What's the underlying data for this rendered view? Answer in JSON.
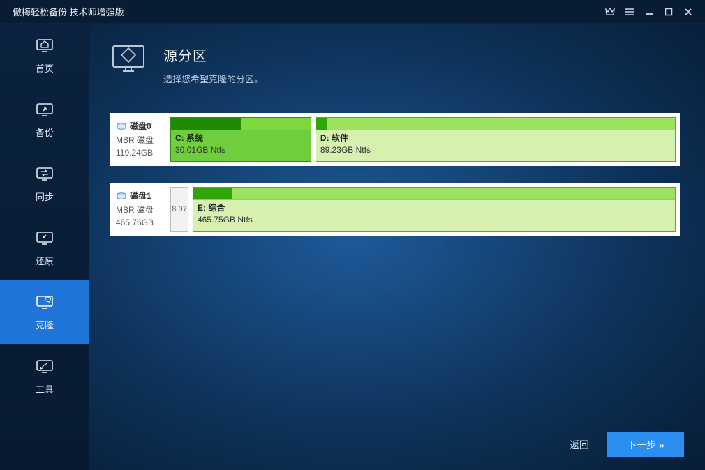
{
  "titlebar": {
    "app_title": "傲梅轻松备份 技术师增强版"
  },
  "sidebar": {
    "items": [
      {
        "label": "首页",
        "icon": "home"
      },
      {
        "label": "备份",
        "icon": "backup"
      },
      {
        "label": "同步",
        "icon": "sync"
      },
      {
        "label": "还原",
        "icon": "restore"
      },
      {
        "label": "克隆",
        "icon": "clone"
      },
      {
        "label": "工具",
        "icon": "tools"
      }
    ],
    "active_index": 4
  },
  "page": {
    "title": "源分区",
    "subtitle": "选择您希望克隆的分区。"
  },
  "disks": [
    {
      "name": "磁盘0",
      "type": "MBR 磁盘",
      "size": "119.24GB",
      "partitions": [
        {
          "label": "C: 系统",
          "info": "30.01GB Ntfs",
          "flex": 28,
          "used_pct": 50,
          "selected": true
        },
        {
          "label": "D: 软件",
          "info": "89.23GB Ntfs",
          "flex": 72,
          "used_pct": 3,
          "selected": false
        }
      ]
    },
    {
      "name": "磁盘1",
      "type": "MBR 磁盘",
      "size": "465.76GB",
      "small_prefix": "8.97",
      "partitions": [
        {
          "label": "E: 综合",
          "info": "465.75GB Ntfs",
          "flex": 100,
          "used_pct": 8,
          "selected": false
        }
      ]
    }
  ],
  "footer": {
    "back": "返回",
    "next": "下一步 »"
  }
}
